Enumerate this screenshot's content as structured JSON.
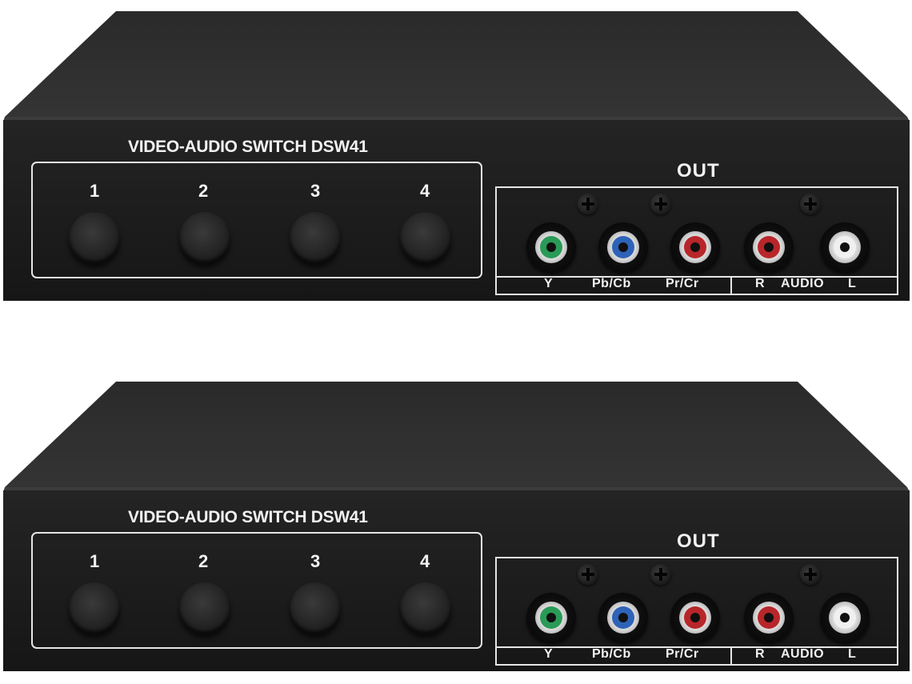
{
  "units": [
    {
      "model_label": "VIDEO-AUDIO SWITCH DSW41",
      "output_section_label": "OUT",
      "buttons": [
        "1",
        "2",
        "3",
        "4"
      ],
      "ports": [
        {
          "label": "Y",
          "color": "#2a9a57"
        },
        {
          "label": "Pb/Cb",
          "color": "#2e63b8"
        },
        {
          "label": "Pr/Cr",
          "color": "#b8262a"
        },
        {
          "label": "R",
          "color": "#b8262a"
        },
        {
          "label": "L",
          "color": "#f0f0f0"
        }
      ],
      "audio_label": "AUDIO"
    },
    {
      "model_label": "VIDEO-AUDIO SWITCH DSW41",
      "output_section_label": "OUT",
      "buttons": [
        "1",
        "2",
        "3",
        "4"
      ],
      "ports": [
        {
          "label": "Y",
          "color": "#2a9a57"
        },
        {
          "label": "Pb/Cb",
          "color": "#2e63b8"
        },
        {
          "label": "Pr/Cr",
          "color": "#b8262a"
        },
        {
          "label": "R",
          "color": "#b8262a"
        },
        {
          "label": "L",
          "color": "#f0f0f0"
        }
      ],
      "audio_label": "AUDIO"
    }
  ],
  "colors": {
    "chassis_front": "#1e1e1e",
    "chassis_top": "#2c2c2c",
    "panel_line": "#e6e6e6"
  }
}
